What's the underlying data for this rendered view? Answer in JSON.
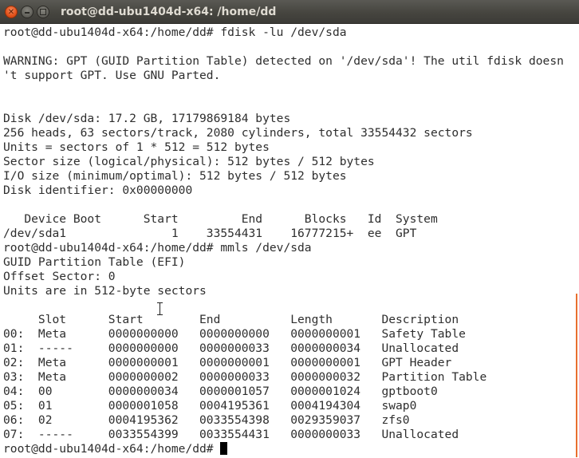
{
  "window": {
    "title": "root@dd-ubu1404d-x64: /home/dd",
    "close_glyph": "✕",
    "accent_close": "#e3511a",
    "titlebar_color": "#3c3b37",
    "scroll_indicator_color": "#e96f2e",
    "icons": {
      "close": "close-icon",
      "minimize": "minimize-icon",
      "maximize": "maximize-icon",
      "text_cursor": "text-cursor-icon"
    }
  },
  "terminal": {
    "lines": [
      "root@dd-ubu1404d-x64:/home/dd# fdisk -lu /dev/sda",
      "",
      "WARNING: GPT (GUID Partition Table) detected on '/dev/sda'! The util fdisk doesn",
      "'t support GPT. Use GNU Parted.",
      "",
      "",
      "Disk /dev/sda: 17.2 GB, 17179869184 bytes",
      "256 heads, 63 sectors/track, 2080 cylinders, total 33554432 sectors",
      "Units = sectors of 1 * 512 = 512 bytes",
      "Sector size (logical/physical): 512 bytes / 512 bytes",
      "I/O size (minimum/optimal): 512 bytes / 512 bytes",
      "Disk identifier: 0x00000000",
      "",
      "   Device Boot      Start         End      Blocks   Id  System",
      "/dev/sda1               1    33554431    16777215+  ee  GPT",
      "root@dd-ubu1404d-x64:/home/dd# mmls /dev/sda",
      "GUID Partition Table (EFI)",
      "Offset Sector: 0",
      "Units are in 512-byte sectors",
      "",
      "     Slot      Start        End          Length       Description",
      "00:  Meta      0000000000   0000000000   0000000001   Safety Table",
      "01:  -----     0000000000   0000000033   0000000034   Unallocated",
      "02:  Meta      0000000001   0000000001   0000000001   GPT Header",
      "03:  Meta      0000000002   0000000033   0000000032   Partition Table",
      "04:  00        0000000034   0000001057   0000001024   gptboot0",
      "05:  01        0000001058   0004195361   0004194304   swap0",
      "06:  02        0004195362   0033554398   0029359037   zfs0",
      "07:  -----     0033554399   0033554431   0000000033   Unallocated"
    ],
    "prompt": "root@dd-ubu1404d-x64:/home/dd# "
  }
}
